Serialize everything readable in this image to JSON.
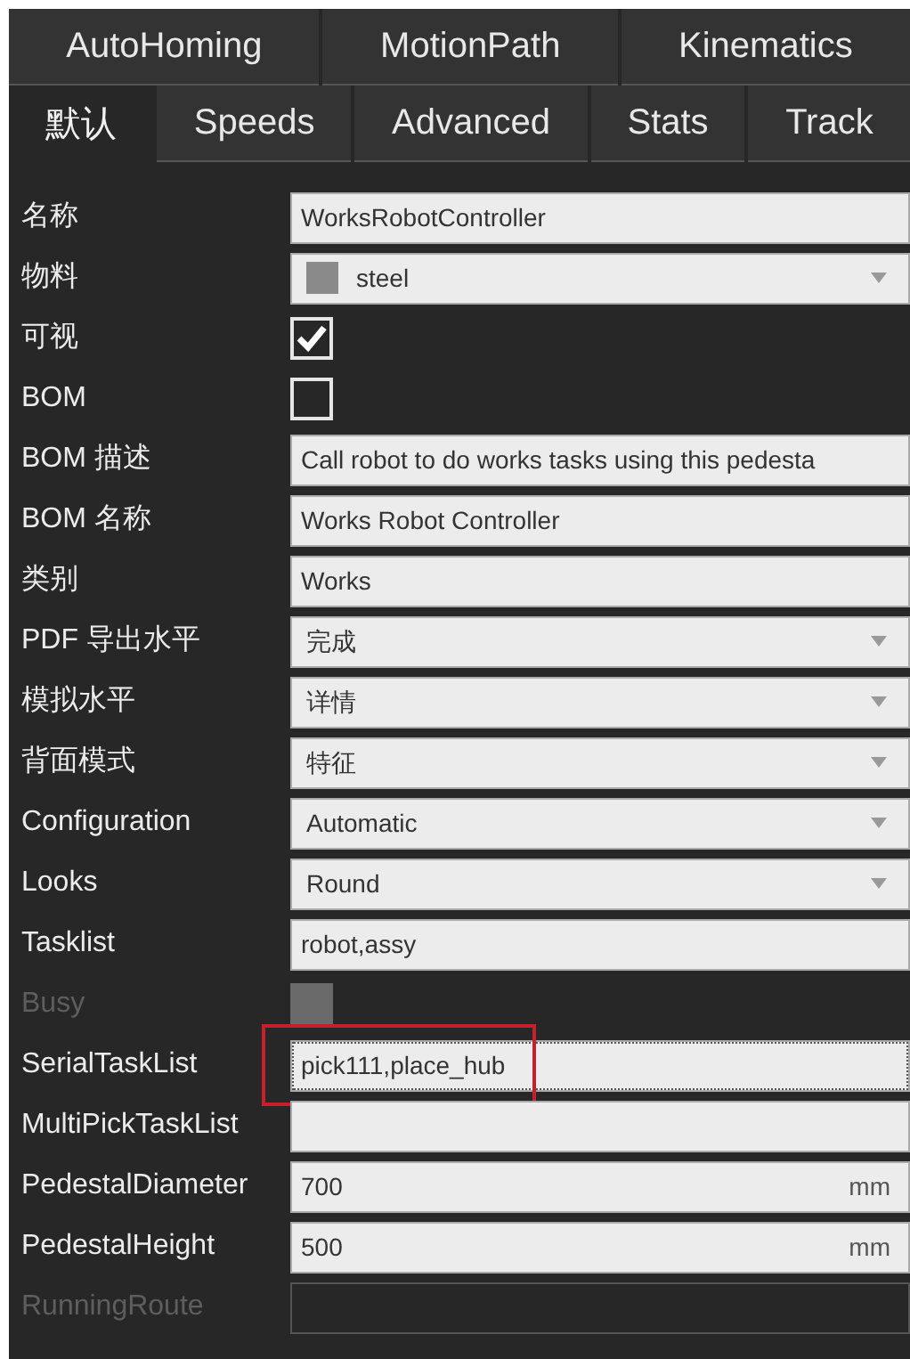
{
  "tab_rows": [
    [
      {
        "label": "AutoHoming",
        "selected": false
      },
      {
        "label": "MotionPath",
        "selected": false
      },
      {
        "label": "Kinematics",
        "selected": false
      }
    ],
    [
      {
        "label": "默认",
        "selected": true
      },
      {
        "label": "Speeds",
        "selected": false
      },
      {
        "label": "Advanced",
        "selected": false
      },
      {
        "label": "Stats",
        "selected": false
      },
      {
        "label": "Track",
        "selected": false
      }
    ]
  ],
  "properties": [
    {
      "label": "名称",
      "kind": "text",
      "value": "WorksRobotController",
      "disabled": false
    },
    {
      "label": "物料",
      "kind": "dropdown",
      "value": "steel",
      "color": "#8a8a8a",
      "disabled": false
    },
    {
      "label": "可视",
      "kind": "checkbox",
      "checked": true,
      "disabled": false
    },
    {
      "label": "BOM",
      "kind": "checkbox",
      "checked": false,
      "disabled": false
    },
    {
      "label": "BOM 描述",
      "kind": "text",
      "value": "Call robot to do works tasks using this pedesta",
      "disabled": false
    },
    {
      "label": "BOM 名称",
      "kind": "text",
      "value": "Works Robot Controller",
      "disabled": false
    },
    {
      "label": "类别",
      "kind": "text",
      "value": "Works",
      "disabled": false
    },
    {
      "label": "PDF 导出水平",
      "kind": "dropdown",
      "value": "完成",
      "disabled": false
    },
    {
      "label": "模拟水平",
      "kind": "dropdown",
      "value": "详情",
      "disabled": false
    },
    {
      "label": "背面模式",
      "kind": "dropdown",
      "value": "特征",
      "disabled": false
    },
    {
      "label": "Configuration",
      "kind": "dropdown",
      "value": "Automatic",
      "disabled": false
    },
    {
      "label": "Looks",
      "kind": "dropdown",
      "value": "Round",
      "disabled": false
    },
    {
      "label": "Tasklist",
      "kind": "text",
      "value": "robot,assy",
      "disabled": false
    },
    {
      "label": "Busy",
      "kind": "checkbox",
      "checked": false,
      "disabled": true
    },
    {
      "label": "SerialTaskList",
      "kind": "text",
      "value": "pick111,place_hub",
      "disabled": false,
      "focused": true,
      "highlighted": true
    },
    {
      "label": "MultiPickTaskList",
      "kind": "text",
      "disabled": false
    },
    {
      "label": "PedestalDiameter",
      "kind": "unit",
      "value": "700",
      "unit": "mm",
      "disabled": false
    },
    {
      "label": "PedestalHeight",
      "kind": "unit",
      "value": "500",
      "unit": "mm",
      "disabled": false
    },
    {
      "label": "RunningRoute",
      "kind": "text",
      "disabled": true
    }
  ]
}
